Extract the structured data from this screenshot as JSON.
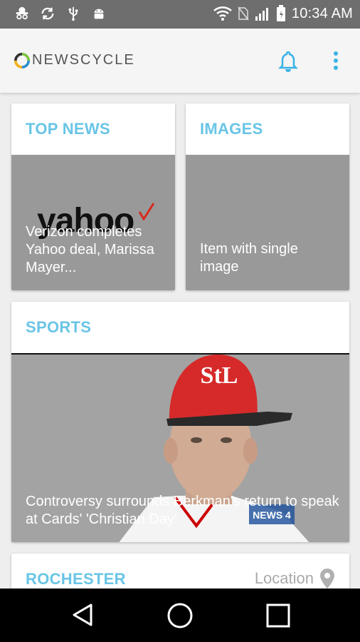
{
  "status_bar": {
    "time": "10:34 AM",
    "icons": [
      "incognito-icon",
      "sync-icon",
      "usb-icon",
      "android-icon",
      "wifi-icon",
      "no-sim-icon",
      "signal-icon",
      "battery-icon"
    ]
  },
  "app_bar": {
    "logo_text": "NEWSCYCLE",
    "icons": [
      "bell-icon",
      "more-vert-icon"
    ],
    "accent_color": "#3ab3e6"
  },
  "cards": {
    "top_news": {
      "title": "TOP NEWS",
      "logo_text": "yahoo",
      "caption": "Verizon completes Yahoo deal, Marissa Mayer..."
    },
    "images": {
      "title": "IMAGES",
      "caption": "Item with single image"
    },
    "sports": {
      "title": "SPORTS",
      "caption": "Controversy surrounds Berkman's return to speak at Cards' 'Christian Day'",
      "watermark": "NEWS 4"
    },
    "rochester": {
      "title": "ROCHESTER",
      "location_label": "Location"
    }
  },
  "nav_bar": {
    "icons": [
      "back-icon",
      "home-icon",
      "recents-icon"
    ]
  },
  "colors": {
    "title_color": "#69c5e6",
    "status_bar": "#6e6e6e",
    "media_gray": "#999999"
  }
}
